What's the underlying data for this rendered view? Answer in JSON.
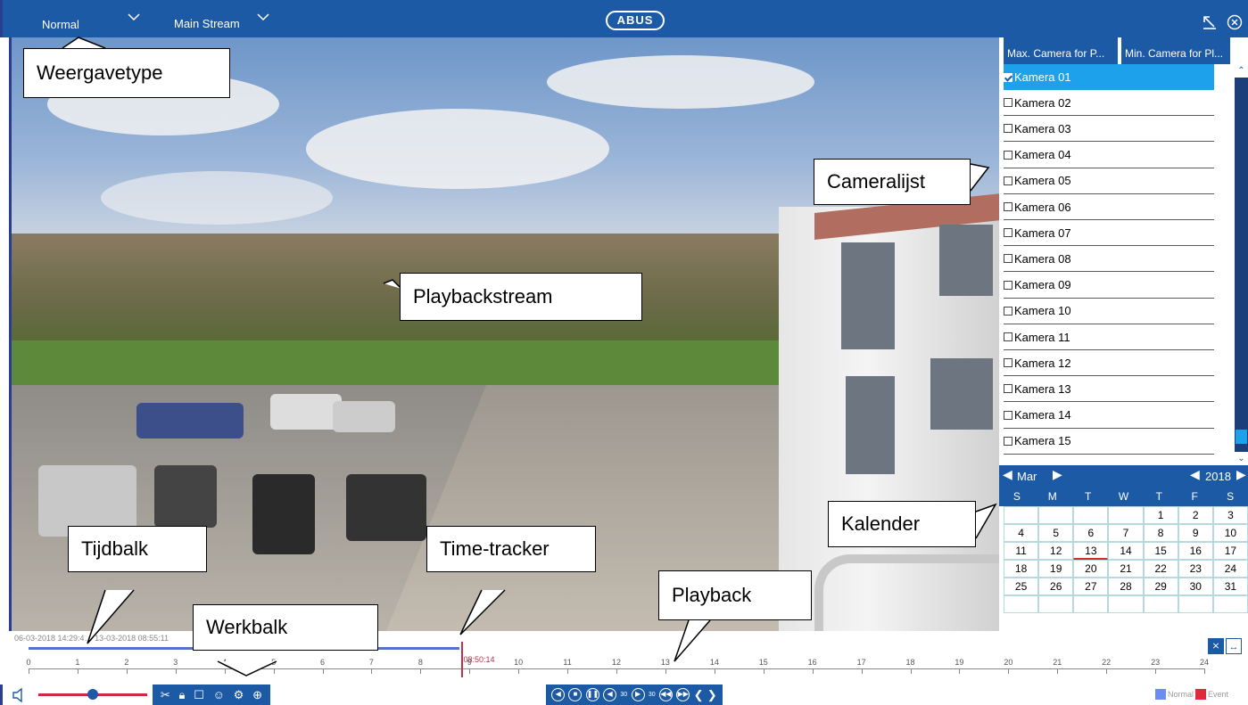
{
  "header": {
    "view_mode": "Normal",
    "stream": "Main Stream",
    "logo": "ABUS",
    "colors": {
      "bar": "#1d5aa6",
      "accent": "#1da1ea",
      "border": "#2a3d8f"
    }
  },
  "callouts": {
    "view_type": "Weergavetype",
    "playback_stream": "Playbackstream",
    "camera_list": "Cameralijst",
    "calendar": "Kalender",
    "timebar": "Tijdbalk",
    "time_tracker": "Time-tracker",
    "playback": "Playback",
    "toolbar": "Werkbalk"
  },
  "sidebar": {
    "tabs": [
      "Max. Camera for P...",
      "Min. Camera for Pl..."
    ],
    "cameras": [
      {
        "name": "Kamera 01",
        "checked": true
      },
      {
        "name": "Kamera 02",
        "checked": false
      },
      {
        "name": "Kamera 03",
        "checked": false
      },
      {
        "name": "Kamera 04",
        "checked": false
      },
      {
        "name": "Kamera 05",
        "checked": false
      },
      {
        "name": "Kamera 06",
        "checked": false
      },
      {
        "name": "Kamera 07",
        "checked": false
      },
      {
        "name": "Kamera 08",
        "checked": false
      },
      {
        "name": "Kamera 09",
        "checked": false
      },
      {
        "name": "Kamera 10",
        "checked": false
      },
      {
        "name": "Kamera 11",
        "checked": false
      },
      {
        "name": "Kamera 12",
        "checked": false
      },
      {
        "name": "Kamera 13",
        "checked": false
      },
      {
        "name": "Kamera 14",
        "checked": false
      },
      {
        "name": "Kamera 15",
        "checked": false
      }
    ]
  },
  "calendar": {
    "month": "Mar",
    "year": "2018",
    "weekdays": [
      "S",
      "M",
      "T",
      "W",
      "T",
      "F",
      "S"
    ],
    "rows": [
      [
        "",
        "",
        "",
        "",
        "1",
        "2",
        "3"
      ],
      [
        "4",
        "5",
        "6",
        "7",
        "8",
        "9",
        "10"
      ],
      [
        "11",
        "12",
        "13",
        "14",
        "15",
        "16",
        "17"
      ],
      [
        "18",
        "19",
        "20",
        "21",
        "22",
        "23",
        "24"
      ],
      [
        "25",
        "26",
        "27",
        "28",
        "29",
        "30",
        "31"
      ],
      [
        "",
        "",
        "",
        "",
        "",
        "",
        ""
      ]
    ],
    "today": "13"
  },
  "timeline": {
    "range_text": "06-03-2018 14:29:4… 13-03-2018 08:55:11",
    "hours": [
      "0",
      "1",
      "2",
      "3",
      "4",
      "5",
      "6",
      "7",
      "8",
      "9",
      "10",
      "11",
      "12",
      "13",
      "14",
      "15",
      "16",
      "17",
      "18",
      "19",
      "20",
      "21",
      "22",
      "23",
      "24"
    ],
    "recorded_until_hour": 8.8,
    "cursor_hour": 8.84,
    "cursor_label": "08:50:14"
  },
  "legend": {
    "normal": "Normal",
    "event": "Event",
    "normal_color": "#6b8cf0",
    "event_color": "#e02a3a"
  },
  "icons": {
    "toolbar": [
      "scissors-icon",
      "lock-icon",
      "bookmark-icon",
      "person-search-icon",
      "settings-icon",
      "zoom-icon"
    ],
    "playback": [
      "reverse-play-icon",
      "stop-icon",
      "pause-icon",
      "back-30s-icon",
      "forward-30s-icon",
      "slow-icon",
      "fast-icon",
      "prev-icon",
      "next-icon"
    ]
  },
  "playback_labels": {
    "back_30": "30",
    "forward_30": "30"
  }
}
